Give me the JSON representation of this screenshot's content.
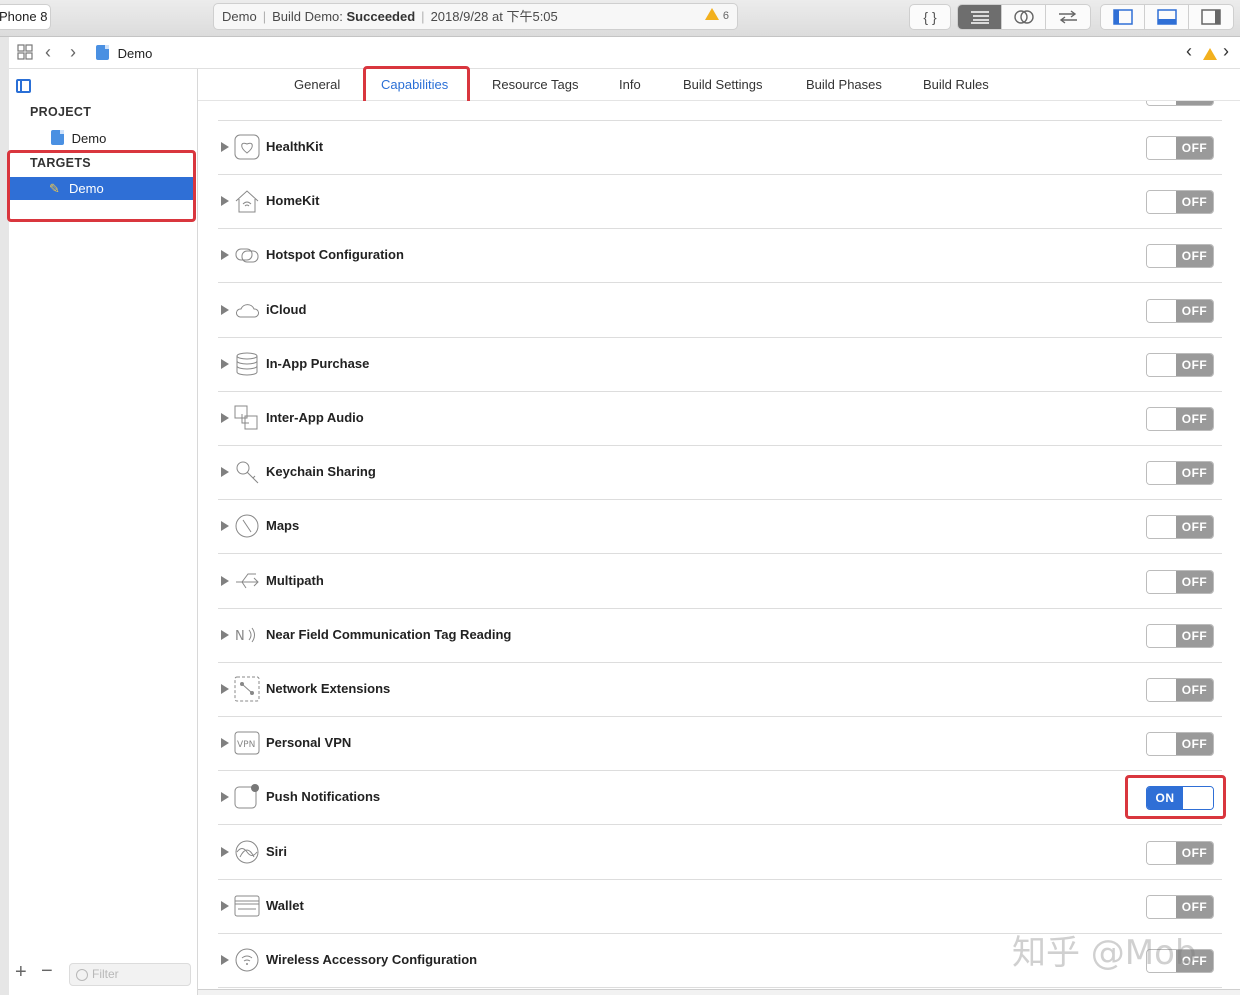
{
  "toolbar": {
    "scheme_device": "Phone 8",
    "activity": {
      "project": "Demo",
      "build_label": "Build Demo:",
      "build_status": "Succeeded",
      "timestamp": "2018/9/28 at 下午5:05",
      "warning_count": "6"
    },
    "code_button": "{ }"
  },
  "jumpbar": {
    "file": "Demo"
  },
  "sidebar": {
    "project_header": "PROJECT",
    "project_item": "Demo",
    "targets_header": "TARGETS",
    "target_item": "Demo",
    "filter_placeholder": "Filter"
  },
  "tabs": [
    "General",
    "Capabilities",
    "Resource Tags",
    "Info",
    "Build Settings",
    "Build Phases",
    "Build Rules"
  ],
  "active_tab": "Capabilities",
  "capabilities": [
    {
      "label": "HealthKit",
      "icon": "heart-icon",
      "state": "OFF"
    },
    {
      "label": "HomeKit",
      "icon": "home-icon",
      "state": "OFF"
    },
    {
      "label": "Hotspot Configuration",
      "icon": "hotspot-icon",
      "state": "OFF"
    },
    {
      "label": "iCloud",
      "icon": "cloud-icon",
      "state": "OFF"
    },
    {
      "label": "In-App Purchase",
      "icon": "coins-icon",
      "state": "OFF"
    },
    {
      "label": "Inter-App Audio",
      "icon": "audio-icon",
      "state": "OFF"
    },
    {
      "label": "Keychain Sharing",
      "icon": "key-icon",
      "state": "OFF"
    },
    {
      "label": "Maps",
      "icon": "compass-icon",
      "state": "OFF"
    },
    {
      "label": "Multipath",
      "icon": "multipath-icon",
      "state": "OFF"
    },
    {
      "label": "Near Field Communication Tag Reading",
      "icon": "nfc-icon",
      "state": "OFF"
    },
    {
      "label": "Network Extensions",
      "icon": "network-icon",
      "state": "OFF"
    },
    {
      "label": "Personal VPN",
      "icon": "vpn-icon",
      "state": "OFF"
    },
    {
      "label": "Push Notifications",
      "icon": "notification-icon",
      "state": "ON"
    },
    {
      "label": "Siri",
      "icon": "siri-icon",
      "state": "OFF"
    },
    {
      "label": "Wallet",
      "icon": "wallet-icon",
      "state": "OFF"
    },
    {
      "label": "Wireless Accessory Configuration",
      "icon": "wireless-icon",
      "state": "OFF"
    }
  ],
  "watermark": "知乎 @Mob",
  "colors": {
    "accent": "#2f6fd6",
    "highlight_box": "#d9363e",
    "switch_off": "#9a9a9a"
  }
}
